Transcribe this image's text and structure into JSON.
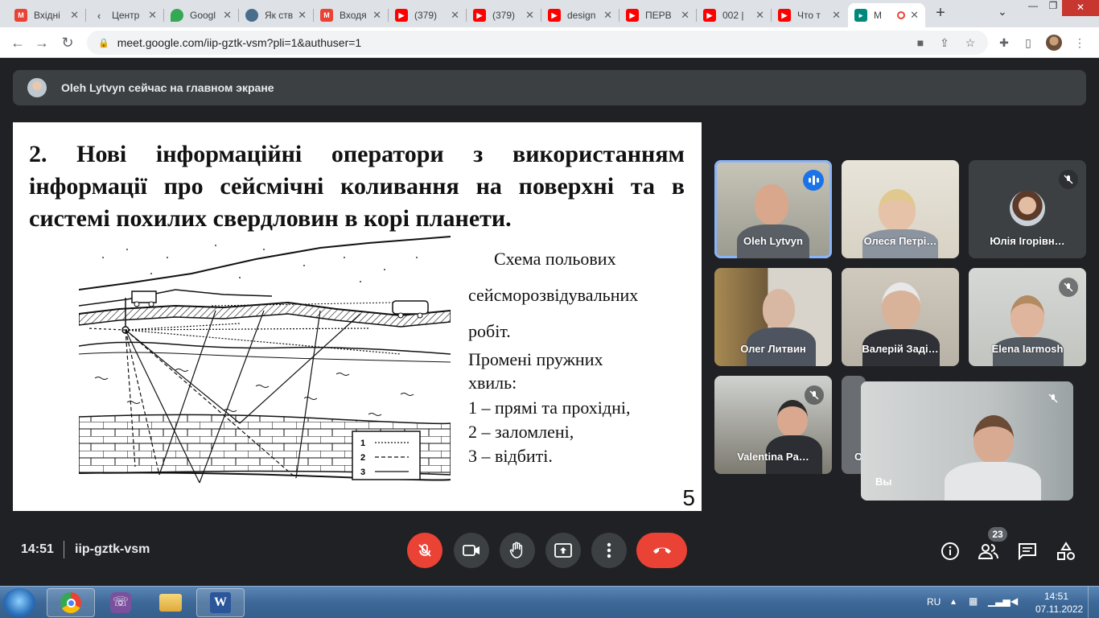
{
  "browser": {
    "tabs": [
      {
        "title": "Вхідні",
        "icon": "gmail-icon",
        "color": "#ea4335"
      },
      {
        "title": "Центр",
        "icon": "arrow-icon",
        "color": "#5f6368"
      },
      {
        "title": "Googl",
        "icon": "maps-icon",
        "color": "#34a853"
      },
      {
        "title": "Як ств",
        "icon": "globe-icon",
        "color": "#1a73e8"
      },
      {
        "title": "Входя",
        "icon": "gmail-icon",
        "color": "#ea4335"
      },
      {
        "title": "(379)",
        "icon": "youtube-icon",
        "color": "#ff0000"
      },
      {
        "title": "(379)",
        "icon": "youtube-icon",
        "color": "#ff0000"
      },
      {
        "title": "design",
        "icon": "youtube-icon",
        "color": "#ff0000"
      },
      {
        "title": "ПЕРВ",
        "icon": "youtube-icon",
        "color": "#ff0000"
      },
      {
        "title": "002 |",
        "icon": "youtube-icon",
        "color": "#ff0000"
      },
      {
        "title": "Что т",
        "icon": "youtube-icon",
        "color": "#ff0000"
      },
      {
        "title": "M",
        "icon": "meet-icon",
        "color": "#00897b"
      }
    ],
    "url": "meet.google.com/iip-gztk-vsm?pli=1&authuser=1"
  },
  "meet": {
    "banner_text": "Oleh Lytvyn сейчас на главном экране",
    "slide": {
      "title": "2. Нові інформаційні оператори з використанням інформації про сейсмічні коливання на поверхні та в системі похилих свердловин в корі планети.",
      "caption_line1": "Схема польових",
      "caption_line2": "сейсморозвідувальних",
      "caption_line3": "робіт.",
      "rays_title": "Промені пружних",
      "rays_title2": "хвиль:",
      "ray1": "1 – прямі та прохідні,",
      "ray2": "2 – заломлені,",
      "ray3": "3 – відбиті.",
      "legend": [
        "1",
        "2",
        "3"
      ],
      "page_number": "5"
    },
    "participants": [
      {
        "name": "Oleh Lytvyn",
        "speaking": true,
        "muted": false
      },
      {
        "name": "Олеся Петрі…",
        "speaking": false,
        "muted": false
      },
      {
        "name": "Юлія Ігорівн…",
        "speaking": false,
        "muted": true
      },
      {
        "name": "Олег Литвин",
        "speaking": false,
        "muted": false
      },
      {
        "name": "Валерій Заді…",
        "speaking": false,
        "muted": false
      },
      {
        "name": "Elena Iarmosh",
        "speaking": false,
        "muted": true
      },
      {
        "name": "Valentina Pa…",
        "speaking": false,
        "muted": true
      },
      {
        "name": "O",
        "speaking": false,
        "muted": false
      }
    ],
    "self_name": "Вы",
    "time": "14:51",
    "meeting_code": "iip-gztk-vsm",
    "participant_count": "23"
  },
  "taskbar": {
    "lang": "RU",
    "time": "14:51",
    "date": "07.11.2022"
  }
}
